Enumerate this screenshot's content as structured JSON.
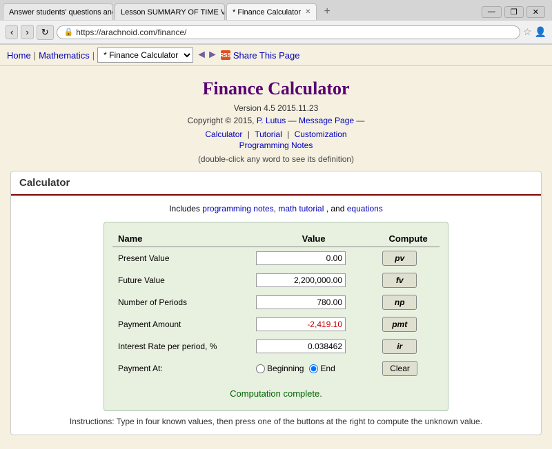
{
  "browser": {
    "tabs": [
      {
        "id": "tab1",
        "label": "Answer students' questions and...",
        "active": false
      },
      {
        "id": "tab2",
        "label": "Lesson SUMMARY OF TIME VALU...",
        "active": false
      },
      {
        "id": "tab3",
        "label": "* Finance Calculator",
        "active": true
      }
    ],
    "win_controls": [
      "—",
      "❒",
      "✕"
    ],
    "address": "https://arachnoid.com/finance/"
  },
  "toolbar": {
    "home_label": "Home",
    "math_label": "Mathematics",
    "page_selector_value": "* Finance Calculator",
    "share_label": "Share This Page"
  },
  "page": {
    "title": "Finance Calculator",
    "version": "Version 4.5 2015.11.23",
    "copyright": "Copyright © 2015,",
    "author_link": "P. Lutus",
    "dash1": "—",
    "message_link": "Message Page",
    "dash2": "—",
    "nav_calculator": "Calculator",
    "nav_sep1": "|",
    "nav_tutorial": "Tutorial",
    "nav_sep2": "|",
    "nav_customization": "Customization",
    "nav_programming": "Programming Notes",
    "double_click_note": "(double-click any word to see its definition)"
  },
  "calculator_section": {
    "heading": "Calculator",
    "includes_text": "Includes",
    "prog_notes_link": "programming notes",
    "comma1": ",",
    "math_tutorial_link": "math tutorial",
    "and_text": ", and",
    "equations_link": "equations",
    "table": {
      "col_name": "Name",
      "col_value": "Value",
      "col_compute": "Compute",
      "rows": [
        {
          "label": "Present Value",
          "value": "0.00",
          "negative": false,
          "btn_label": "pv",
          "btn_id": "pv-button"
        },
        {
          "label": "Future Value",
          "value": "2,200,000.00",
          "negative": false,
          "btn_label": "fv",
          "btn_id": "fv-button"
        },
        {
          "label": "Number of Periods",
          "value": "780.00",
          "negative": false,
          "btn_label": "np",
          "btn_id": "np-button"
        },
        {
          "label": "Payment Amount",
          "value": "-2,419.10",
          "negative": true,
          "btn_label": "pmt",
          "btn_id": "pmt-button"
        },
        {
          "label": "Interest Rate per period, %",
          "value": "0.038462",
          "negative": false,
          "btn_label": "ir",
          "btn_id": "ir-button"
        }
      ],
      "payment_at_label": "Payment At:",
      "radio_beginning": "Beginning",
      "radio_end": "End",
      "clear_btn_label": "Clear",
      "computation_complete": "Computation complete."
    }
  },
  "instructions": "Instructions: Type in four known values, then press one of the buttons at the right to compute the unknown value."
}
